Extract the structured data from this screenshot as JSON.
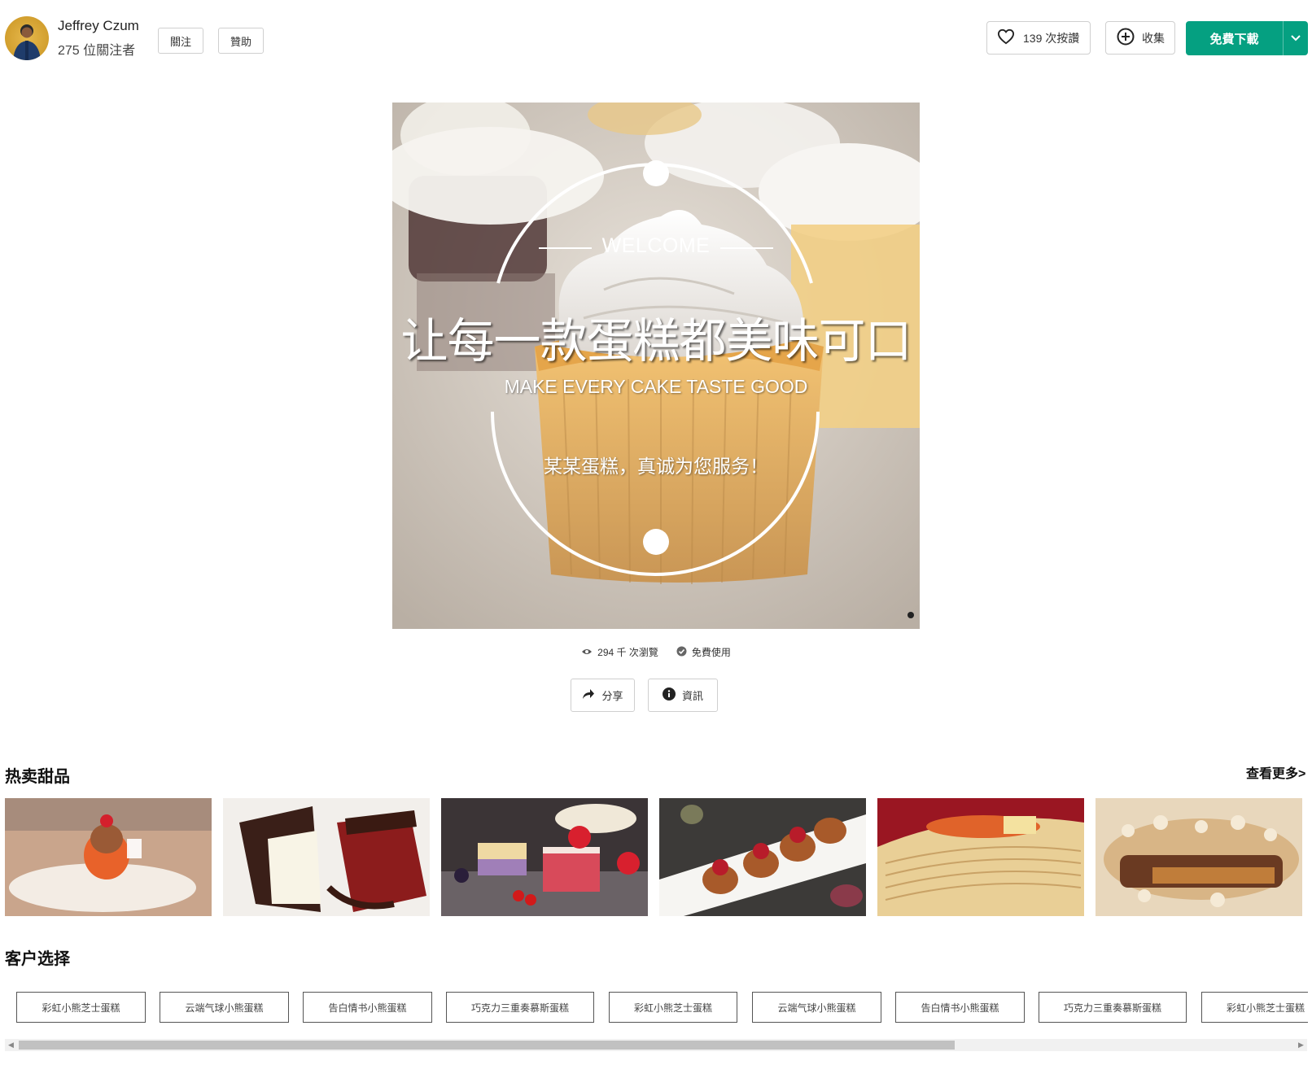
{
  "author": {
    "name": "Jeffrey Czum",
    "followers": "275 位關注者",
    "follow_label": "關注",
    "support_label": "贊助"
  },
  "actions": {
    "like_label": "139 次按讚",
    "collect_label": "收集",
    "download_label": "免費下載"
  },
  "hero": {
    "welcome": "WELCOME",
    "title": "让每一款蛋糕都美味可口",
    "subtitle": "MAKE EVERY CAKE TASTE GOOD",
    "slogan": "某某蛋糕，真诚为您服务！"
  },
  "stats": {
    "views": "294 千 次瀏覽",
    "license": "免費使用"
  },
  "buttons": {
    "share_label": "分享",
    "info_label": "資訊"
  },
  "hot": {
    "title": "热卖甜品",
    "see_more": "查看更多>"
  },
  "choice": {
    "title": "客户选择",
    "tags": [
      "彩虹小熊芝士蛋糕",
      "云端气球小熊蛋糕",
      "告白情书小熊蛋糕",
      "巧克力三重奏慕斯蛋糕",
      "彩虹小熊芝士蛋糕",
      "云端气球小熊蛋糕",
      "告白情书小熊蛋糕",
      "巧克力三重奏慕斯蛋糕",
      "彩虹小熊芝士蛋糕"
    ]
  },
  "colors": {
    "accent": "#05a081",
    "border": "#cfcfcf"
  }
}
